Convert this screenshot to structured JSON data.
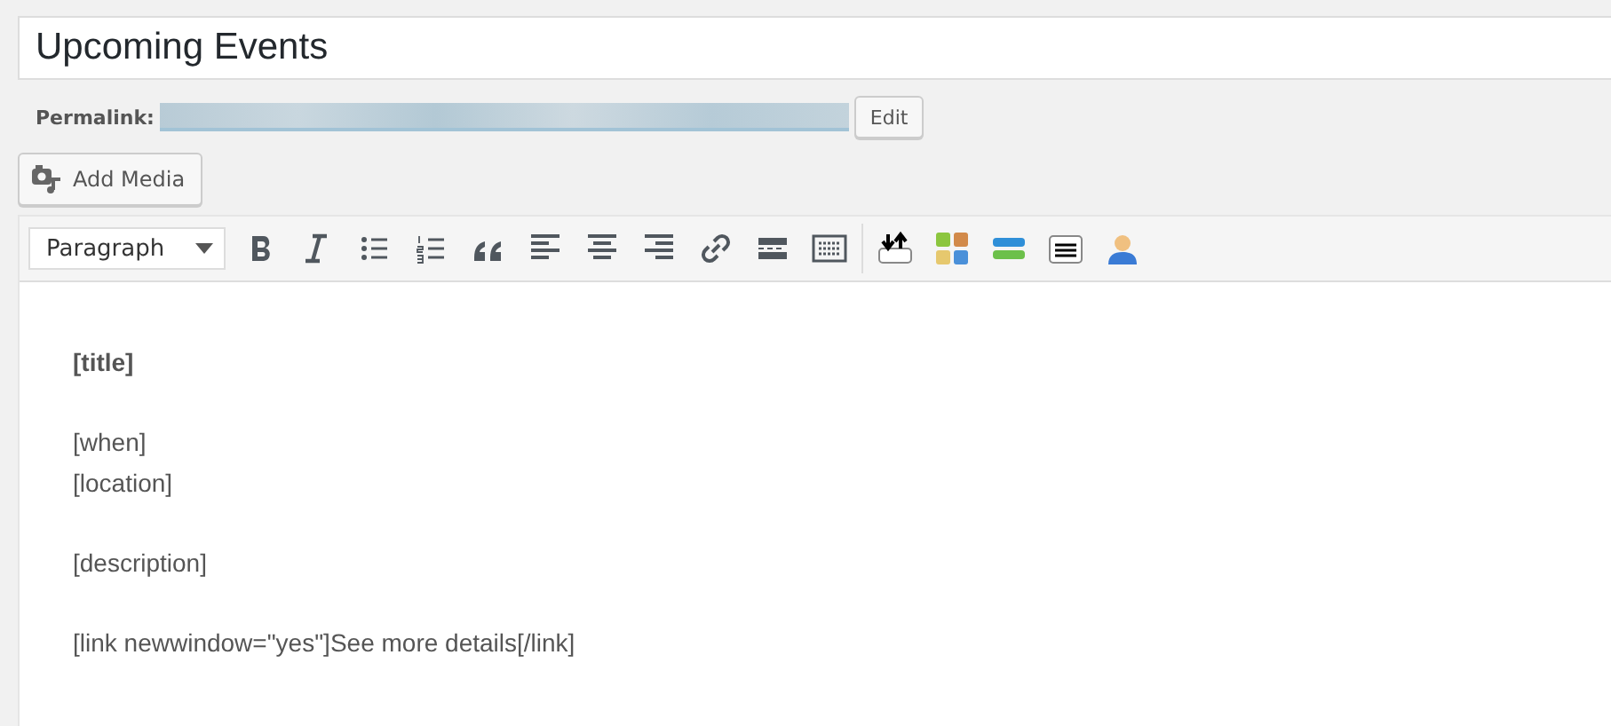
{
  "title_field": {
    "value": "Upcoming Events"
  },
  "permalink": {
    "label": "Permalink:",
    "button": "Edit"
  },
  "add_media": {
    "label": "Add Media"
  },
  "toolbar": {
    "format": "Paragraph"
  },
  "content": [
    {
      "lines": [
        "[title]"
      ],
      "bold": true
    },
    {
      "lines": [
        "[when]",
        "[location]"
      ],
      "bold": false
    },
    {
      "lines": [
        "[description]"
      ],
      "bold": false
    },
    {
      "lines": [
        "[link newwindow=\"yes\"]See more details[/link]"
      ],
      "bold": false
    }
  ]
}
